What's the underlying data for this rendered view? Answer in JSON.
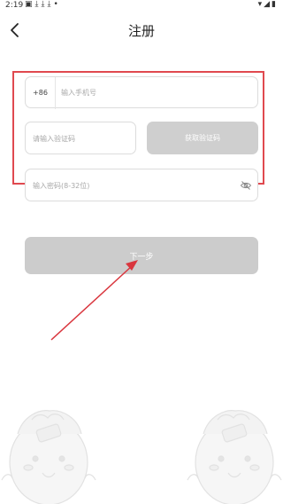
{
  "status_bar": {
    "time": "2:19",
    "icons": [
      "image-icon",
      "download-icon",
      "download-icon",
      "download-icon",
      "dot-icon"
    ],
    "right_icons": [
      "wifi-icon",
      "signal-icon",
      "battery-icon"
    ]
  },
  "header": {
    "title": "注册"
  },
  "form": {
    "country_code": "+86",
    "phone_placeholder": "输入手机号",
    "code_placeholder": "请输入验证码",
    "get_code_label": "获取验证码",
    "password_placeholder": "输入密码(8-32位)"
  },
  "next_button": {
    "label": "下一步"
  },
  "colors": {
    "highlight_border": "#e0494f",
    "arrow": "#d9363e",
    "disabled_button": "#cccccc",
    "field_border": "#dcdcdc"
  }
}
